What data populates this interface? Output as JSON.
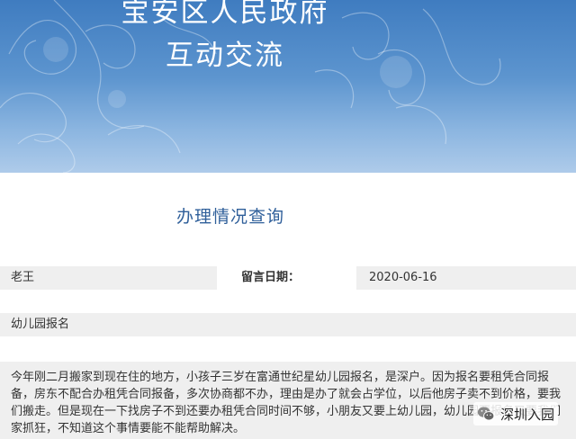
{
  "header": {
    "title_line1": "宝安区人民政府",
    "title_line2": "互动交流"
  },
  "section": {
    "title": "办理情况查询"
  },
  "message": {
    "author": "老王",
    "date_label": "留言日期：",
    "date_value": "2020-06-16",
    "subject": "幼儿园报名",
    "body": "今年刚二月搬家到现在住的地方，小孩子三岁在富通世纪星幼儿园报名，是深户。因为报名要租凭合同报备，房东不配合办租凭合同报备，多次协商都不办，理由是办了就会占学位，以后他房子卖不到价格，要我们搬走。但是现在一下找房子不到还要办租凭合同时间不够，小朋友又要上幼儿园，幼儿园要报名又要我们家抓狂，不知道这个事情要能不能帮助解决。"
  },
  "watermark": {
    "text": "深圳入园",
    "icon": "wechat-icon"
  },
  "colors": {
    "banner_top": "#3f7cc0",
    "banner_bottom": "#aecbea",
    "section_title": "#2f5f9a",
    "field_bg": "#efefef"
  }
}
